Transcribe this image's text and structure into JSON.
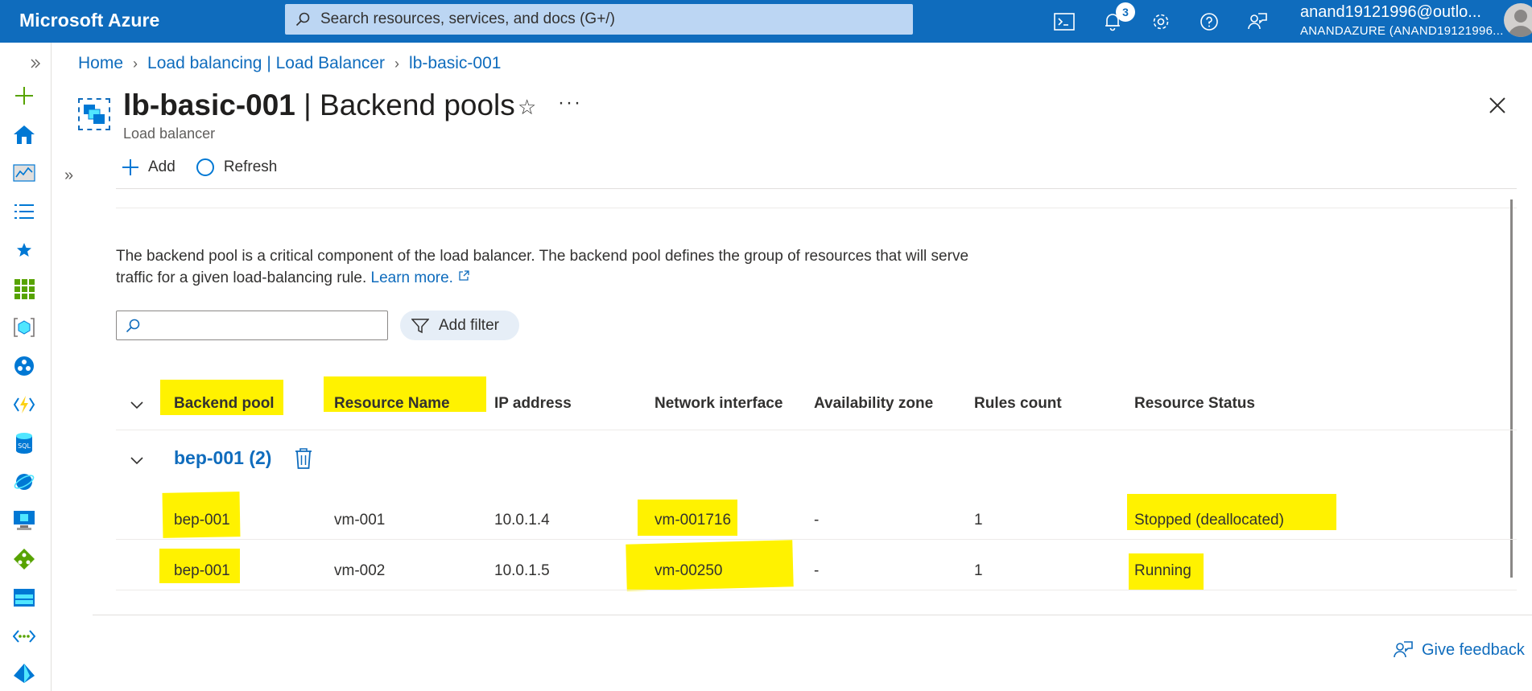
{
  "topbar": {
    "brand": "Microsoft Azure",
    "search_placeholder": "Search resources, services, and docs (G+/)",
    "notifications_count": "3",
    "account_email": "anand19121996@outlo...",
    "account_tenant": "ANANDAZURE (ANAND19121996..."
  },
  "breadcrumb": {
    "home": "Home",
    "parent": "Load balancing | Load Balancer",
    "current": "lb-basic-001"
  },
  "header": {
    "resource_name": "lb-basic-001",
    "separator": " | ",
    "blade_name": "Backend pools",
    "resource_type": "Load balancer"
  },
  "toolbar": {
    "add_label": "Add",
    "refresh_label": "Refresh"
  },
  "description": {
    "text": "The backend pool is a critical component of the load balancer. The backend pool defines the group of resources that will serve traffic for a given load-balancing rule.",
    "learn_more": "Learn more."
  },
  "filter": {
    "add_filter_label": "Add filter"
  },
  "table": {
    "columns": [
      "Backend pool",
      "Resource Name",
      "IP address",
      "Network interface",
      "Availability zone",
      "Rules count",
      "Resource Status"
    ],
    "group": {
      "label": "bep-001 (2)"
    },
    "rows": [
      {
        "backend_pool": "bep-001",
        "resource_name": "vm-001",
        "ip": "10.0.1.4",
        "nic": "vm-001716",
        "zone": "-",
        "rules": "1",
        "status": "Stopped (deallocated)"
      },
      {
        "backend_pool": "bep-001",
        "resource_name": "vm-002",
        "ip": "10.0.1.5",
        "nic": "vm-00250",
        "zone": "-",
        "rules": "1",
        "status": "Running"
      }
    ]
  },
  "footer": {
    "feedback_label": "Give feedback"
  },
  "colors": {
    "accent": "#0f6cbd",
    "highlight": "#fff200"
  }
}
